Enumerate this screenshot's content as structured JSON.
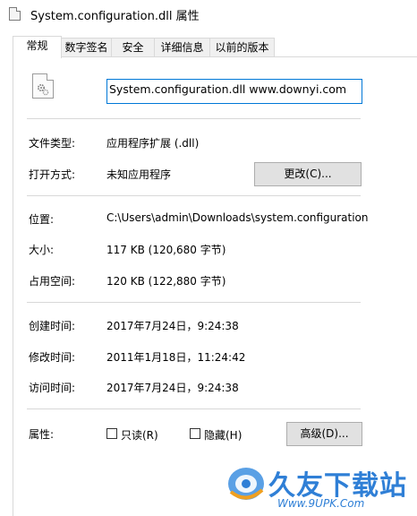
{
  "window": {
    "title": "System.configuration.dll 属性"
  },
  "tabs": [
    "常规",
    "数字签名",
    "安全",
    "详细信息",
    "以前的版本"
  ],
  "file": {
    "name": "System.configuration.dll www.downyi.com"
  },
  "type_section": {
    "file_type_label": "文件类型:",
    "file_type_value": "应用程序扩展 (.dll)",
    "open_with_label": "打开方式:",
    "open_with_value": "未知应用程序",
    "change_button": "更改(C)..."
  },
  "location_section": {
    "location_label": "位置:",
    "location_value": "C:\\Users\\admin\\Downloads\\system.configuration",
    "size_label": "大小:",
    "size_value": "117 KB (120,680 字节)",
    "size_on_disk_label": "占用空间:",
    "size_on_disk_value": "120 KB (122,880 字节)"
  },
  "time_section": {
    "created_label": "创建时间:",
    "created_value": "2017年7月24日，9:24:38",
    "modified_label": "修改时间:",
    "modified_value": "2011年1月18日，11:24:42",
    "accessed_label": "访问时间:",
    "accessed_value": "2017年7月24日，9:24:38"
  },
  "attributes": {
    "label": "属性:",
    "readonly": "只读(R)",
    "hidden": "隐藏(H)",
    "advanced_button": "高级(D)..."
  },
  "watermark": {
    "title": "久友下载站",
    "subtitle": "Www.9UPK.Com"
  },
  "colors": {
    "accent": "#0078d7",
    "watermark": "#2f7fd6"
  }
}
